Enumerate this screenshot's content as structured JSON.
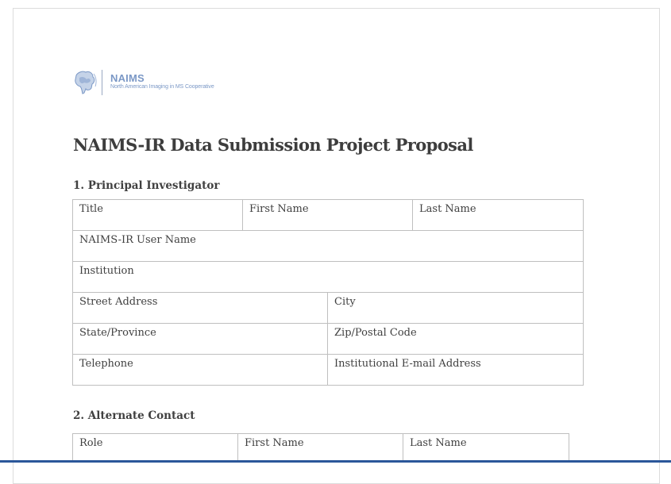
{
  "logo": {
    "name": "NAIMS",
    "tagline": "North American Imaging in MS Cooperative"
  },
  "document": {
    "title": "NAIMS-IR Data Submission Project Proposal"
  },
  "section1": {
    "heading": "1. Principal Investigator",
    "fields": {
      "title": "Title",
      "first_name": "First Name",
      "last_name": "Last Name",
      "user_name": "NAIMS-IR User Name",
      "institution": "Institution",
      "street_address": "Street Address",
      "city": "City",
      "state_province": "State/Province",
      "zip_postal": "Zip/Postal Code",
      "telephone": "Telephone",
      "email": "Institutional E-mail Address"
    }
  },
  "section2": {
    "heading": "2. Alternate Contact",
    "fields": {
      "role": "Role",
      "first_name": "First Name",
      "last_name": "Last Name"
    }
  },
  "colors": {
    "accent_bar": "#2b579a",
    "logo_blue": "#7b98c6",
    "table_border": "#bfbfbf"
  }
}
